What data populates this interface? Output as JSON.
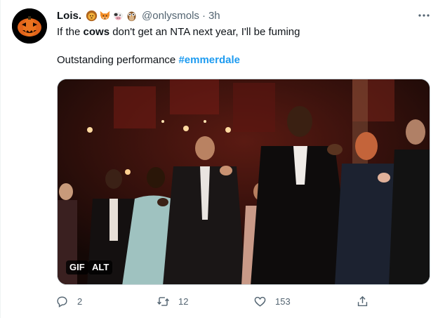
{
  "tweet": {
    "display_name": "Lois.",
    "emojis": [
      "lion-face",
      "fox-face",
      "cow-face",
      "owl"
    ],
    "handle": "@onlysmols",
    "separator": "·",
    "time": "3h",
    "text_line1_a": "If the ",
    "text_line1_bold": "cows",
    "text_line1_b": " don't get an NTA next year, I'll be fuming",
    "text_line2": "Outstanding performance ",
    "hashtag": "#emmerdale",
    "media": {
      "type": "gif",
      "gif_badge": "GIF",
      "alt_badge": "ALT"
    },
    "actions": {
      "reply_count": "2",
      "retweet_count": "12",
      "like_count": "153"
    }
  },
  "colors": {
    "text": "#0f1419",
    "secondary": "#536471",
    "link": "#1d9bf0"
  }
}
